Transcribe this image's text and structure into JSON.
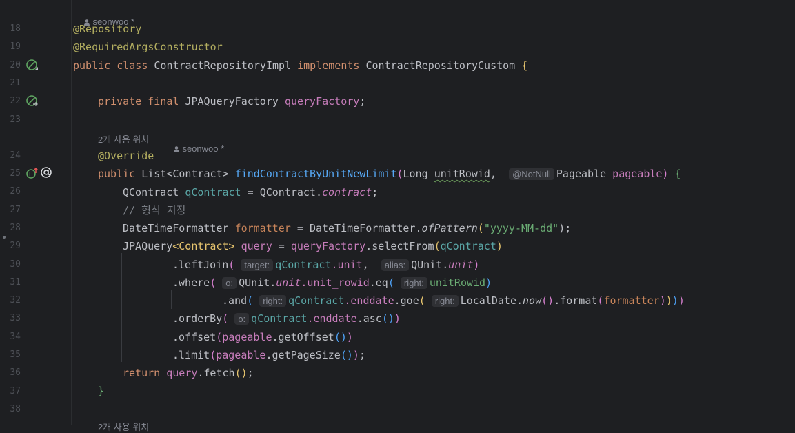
{
  "editor": {
    "author_hint_1": "seonwoo *",
    "author_hint_2": "seonwoo *",
    "usages_hint": "2개 사용 위치",
    "usages_hint_bottom": "2개 사용 위치",
    "line_numbers": [
      "18",
      "19",
      "20",
      "21",
      "22",
      "23",
      "24",
      "25",
      "26",
      "27",
      "28",
      "29",
      "30",
      "31",
      "32",
      "33",
      "34",
      "35",
      "36",
      "37",
      "38"
    ],
    "gutter_icons": {
      "line20": "bean-class-icon",
      "line22": "bean-injection-icon",
      "line25_a": "implements-method-icon",
      "line25_b": "at-annotation-icon"
    },
    "code": {
      "l18_ann": "@Repository",
      "l19_ann": "@RequiredArgsConstructor",
      "l20_kw": "public class",
      "l20_name": "ContractRepositoryImpl",
      "l20_impl": "implements",
      "l20_iface": "ContractRepositoryCustom",
      "l20_brace": "{",
      "l22_kw": "private final",
      "l22_type": "JPAQueryFactory",
      "l22_field": "queryFactory",
      "l22_semi": ";",
      "l24_ann": "@Override",
      "l25_kw": "public",
      "l25_ret": "List<Contract>",
      "l25_method": "findContractByUnitNewLimit",
      "l25_paren": "(",
      "l25_p1type": "Long",
      "l25_p1": "unitRowid",
      "l25_comma": ",",
      "l25_hint": "@NotNull",
      "l25_p2type": "Pageable",
      "l25_p2": "pageable",
      "l25_close": ")",
      "l25_brace": "{",
      "l26_type": "QContract",
      "l26_var": "qContract",
      "l26_eq": "=",
      "l26_cls": "QContract.",
      "l26_field": "contract",
      "l26_semi": ";",
      "l27_comment": "// 형식 지정",
      "l28_type": "DateTimeFormatter",
      "l28_var": "formatter",
      "l28_eq": "=",
      "l28_cls": "DateTimeFormatter.",
      "l28_method": "ofPattern",
      "l28_str": "\"yyyy-MM-dd\"",
      "l28_end": ");",
      "l29_type": "JPAQuery",
      "l29_generic": "<Contract>",
      "l29_var": "query",
      "l29_eq": "=",
      "l29_fac": "queryFactory",
      "l29_call": ".selectFrom",
      "l29_arg": "qContract",
      "l30_call": ".leftJoin",
      "l30_hint1": "target:",
      "l30_arg1": "qContract",
      "l30_f1": ".unit",
      "l30_comma": ",",
      "l30_hint2": "alias:",
      "l30_arg2": "QUnit.",
      "l30_f2": "unit",
      "l31_call": ".where",
      "l31_hint": "o:",
      "l31_cls": "QUnit.",
      "l31_f1": "unit",
      "l31_f2": ".unit_rowid",
      "l31_eq": ".eq",
      "l31_hint2": "right:",
      "l31_arg": "unitRowid",
      "l32_call": ".and",
      "l32_hint": "right:",
      "l32_arg": "qContract",
      "l32_f": ".enddate",
      "l32_goe": ".goe",
      "l32_hint2": "right:",
      "l32_cls": "LocalDate.",
      "l32_now": "now",
      "l32_fmt": ".format",
      "l32_arg2": "formatter",
      "l33_call": ".orderBy",
      "l33_hint": "o:",
      "l33_arg": "qContract",
      "l33_f": ".enddate",
      "l33_asc": ".asc",
      "l34_call": ".offset",
      "l34_arg": "pageable",
      "l34_m": ".getOffset",
      "l35_call": ".limit",
      "l35_arg": "pageable",
      "l35_m": ".getPageSize",
      "l36_kw": "return",
      "l36_var": "query",
      "l36_m": ".fetch",
      "l37_brace": "}"
    }
  }
}
